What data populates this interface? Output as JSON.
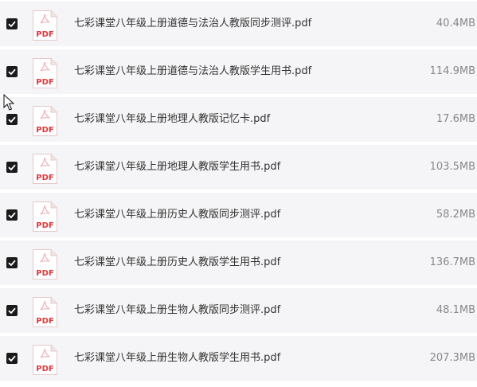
{
  "files": [
    {
      "name": "七彩课堂八年级上册道德与法治人教版同步测评.pdf",
      "size": "40.4MB",
      "checked": true,
      "type_label": "PDF"
    },
    {
      "name": "七彩课堂八年级上册道德与法治人教版学生用书.pdf",
      "size": "114.9MB",
      "checked": true,
      "type_label": "PDF"
    },
    {
      "name": "七彩课堂八年级上册地理人教版记忆卡.pdf",
      "size": "17.6MB",
      "checked": true,
      "type_label": "PDF"
    },
    {
      "name": "七彩课堂八年级上册地理人教版学生用书.pdf",
      "size": "103.5MB",
      "checked": true,
      "type_label": "PDF"
    },
    {
      "name": "七彩课堂八年级上册历史人教版同步测评.pdf",
      "size": "58.2MB",
      "checked": true,
      "type_label": "PDF"
    },
    {
      "name": "七彩课堂八年级上册历史人教版学生用书.pdf",
      "size": "136.7MB",
      "checked": true,
      "type_label": "PDF"
    },
    {
      "name": "七彩课堂八年级上册生物人教版同步测评.pdf",
      "size": "48.1MB",
      "checked": true,
      "type_label": "PDF"
    },
    {
      "name": "七彩课堂八年级上册生物人教版学生用书.pdf",
      "size": "207.3MB",
      "checked": true,
      "type_label": "PDF"
    }
  ],
  "colors": {
    "row_background": "#f5f5f7",
    "checkbox": "#1b1b1b",
    "pdf_red": "#e0393e",
    "text": "#333333",
    "size_text": "#888888"
  },
  "icons": {
    "checkbox": "checkbox-checked-icon",
    "file": "pdf-file-icon",
    "pointer": "mouse-cursor-icon"
  }
}
